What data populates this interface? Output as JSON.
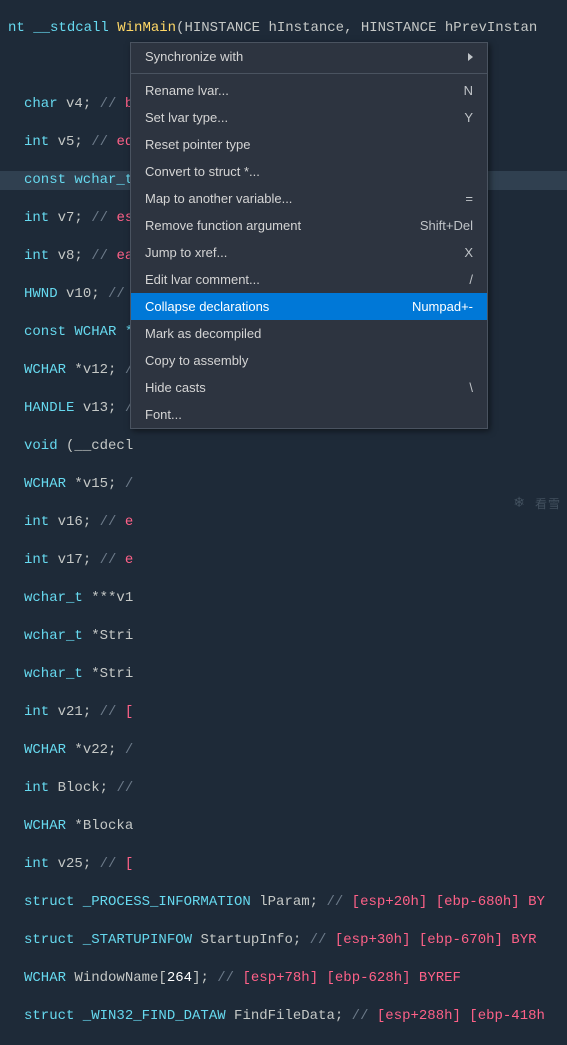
{
  "code": {
    "l0": {
      "t1": "nt ",
      "t2": "__stdcall ",
      "t3": "WinMain",
      "t4": "(HINSTANCE hInstance, HINSTANCE hPrevInstan"
    },
    "l1": "",
    "l2": {
      "t1": "char",
      "t2": " v4; ",
      "t3": "//",
      "t4": " bl"
    },
    "l3": {
      "t1": "int",
      "t2": " v5; ",
      "t3": "//",
      "t4": " edi"
    },
    "l4": {
      "t1": "const wchar_t"
    },
    "l5": {
      "t1": "int",
      "t2": " v7; ",
      "t3": "//",
      "t4": " es"
    },
    "l6": {
      "t1": "int",
      "t2": " v8; ",
      "t3": "//",
      "t4": " ea"
    },
    "l7": {
      "t1": "HWND ",
      "t2": "v10; ",
      "t3": "//"
    },
    "l8": {
      "t1": "const WCHAR *"
    },
    "l9": {
      "t1": "WCHAR ",
      "t2": "*v12; ",
      "t3": "/"
    },
    "l10": {
      "t1": "HANDLE ",
      "t2": "v13; ",
      "t3": "/"
    },
    "l11": {
      "t1": "void ",
      "t2": "(__cdecl"
    },
    "l12": {
      "t1": "WCHAR ",
      "t2": "*v15; ",
      "t3": "/"
    },
    "l13": {
      "t1": "int",
      "t2": " v16; ",
      "t3": "//",
      "t4": " e"
    },
    "l14": {
      "t1": "int",
      "t2": " v17; ",
      "t3": "//",
      "t4": " e"
    },
    "l15": {
      "t1": "wchar_t",
      "t2": " ***v1"
    },
    "l16": {
      "t1": "wchar_t",
      "t2": " *Stri"
    },
    "l17": {
      "t1": "wchar_t",
      "t2": " *Stri"
    },
    "l18": {
      "t1": "int",
      "t2": " v21; ",
      "t3": "//",
      "t4": " ["
    },
    "l19": {
      "t1": "WCHAR ",
      "t2": "*v22; ",
      "t3": "/"
    },
    "l20": {
      "t1": "int",
      "t2": " Block; ",
      "t3": "//"
    },
    "l21": {
      "t1": "WCHAR ",
      "t2": "*Blocka"
    },
    "l22": {
      "t1": "int",
      "t2": " v25; ",
      "t3": "//",
      "t4": " ["
    },
    "l23": {
      "t1": "struct _PROCESS_INFORMATION ",
      "t2": "lParam; ",
      "t3": "//",
      "t4": " [esp+20h] [ebp-680h] BY"
    },
    "l24": {
      "t1": "struct _STARTUPINFOW ",
      "t2": "StartupInfo; ",
      "t3": "//",
      "t4": " [esp+30h] [ebp-670h] BYR"
    },
    "l25": {
      "t1": "WCHAR ",
      "t2": "WindowName[",
      "t3": "264",
      "t4": "]; ",
      "t5": "//",
      "t6": " [esp+78h] [ebp-628h] BYREF"
    },
    "l26": {
      "t1": "struct _WIN32_FIND_DATAW ",
      "t2": "FindFileData; ",
      "t3": "//",
      "t4": " [esp+288h] [ebp-418h"
    }
  },
  "menu": {
    "sync": "Synchronize with",
    "rename": "Rename lvar...",
    "rename_key": "N",
    "settype": "Set lvar type...",
    "settype_key": "Y",
    "resetptr": "Reset pointer type",
    "convert": "Convert to struct *...",
    "map": "Map to another variable...",
    "map_key": "=",
    "removefn": "Remove function argument",
    "removefn_key": "Shift+Del",
    "jump": "Jump to xref...",
    "jump_key": "X",
    "editcmt": "Edit lvar comment...",
    "editcmt_key": "/",
    "collapse": "Collapse declarations",
    "collapse_key": "Numpad+-",
    "markdec": "Mark as decompiled",
    "copyasm": "Copy to assembly",
    "hidecasts": "Hide casts",
    "hidecasts_key": "\\",
    "font": "Font..."
  },
  "watermark": "看雪"
}
